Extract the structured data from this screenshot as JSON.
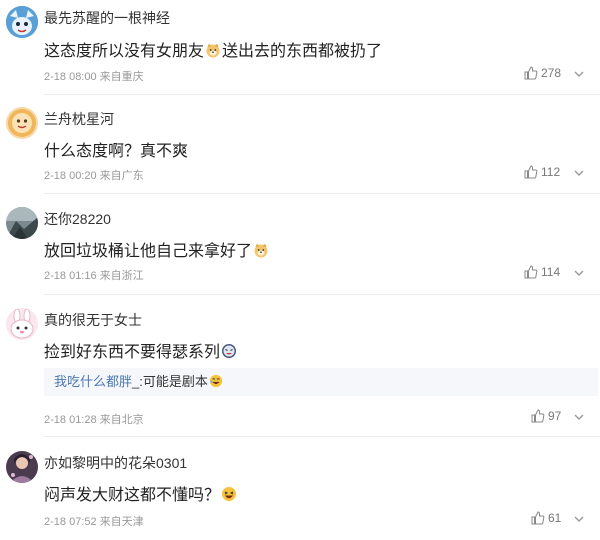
{
  "comments": [
    {
      "username": "最先苏醒的一根神经",
      "text_a": "这态度所以没有女朋友",
      "text_b": "送出去的东西都被扔了",
      "time": "2-18 08:00",
      "location": "来自重庆",
      "likes": "278"
    },
    {
      "username": "兰舟枕星河",
      "text_a": "什么态度啊？真不爽",
      "time": "2-18 00:20",
      "location": "来自广东",
      "likes": "112"
    },
    {
      "username": "还你28220",
      "text_a": "放回垃圾桶让他自己来拿好了",
      "time": "2-18 01:16",
      "location": "来自浙江",
      "likes": "114"
    },
    {
      "username": "真的很无于女士",
      "text_a": "捡到好东西不要得瑟系列",
      "reply_user": "我吃什么都胖",
      "reply_sep": "_:",
      "reply_text": "可能是剧本",
      "time": "2-18 01:28",
      "location": "来自北京",
      "likes": "97"
    },
    {
      "username": "亦如黎明中的花朵0301",
      "text_a": "闷声发大财这都不懂吗？",
      "time": "2-18 07:52",
      "location": "来自天津",
      "likes": "61"
    }
  ],
  "icons": {
    "like": "thumbs-up-icon",
    "more": "chevron-down-icon",
    "emoji_doge": "doge-emoji-icon",
    "emoji_laugh": "laughing-emoji-icon"
  },
  "colors": {
    "reply_user": "#4a79b0",
    "meta": "#999999",
    "divider": "#ececec",
    "reply_bg": "#f5f7fa"
  }
}
